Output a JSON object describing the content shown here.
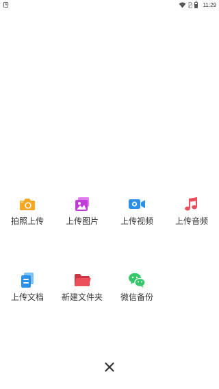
{
  "status_bar": {
    "left_icon": "a-notification-icon",
    "icons": [
      "wifi-icon",
      "no-sim-icon",
      "battery-icon"
    ],
    "battery_text": "",
    "battery_level": 0.6,
    "time": "11:29"
  },
  "actions": [
    {
      "label": "拍照上传",
      "icon": "camera-icon",
      "color": "#F5A623"
    },
    {
      "label": "上传图片",
      "icon": "image-icon",
      "color": "#C13BD8"
    },
    {
      "label": "上传视频",
      "icon": "video-icon",
      "color": "#2B8FE8"
    },
    {
      "label": "上传音频",
      "icon": "music-note-icon",
      "color": "#EC4E5E"
    },
    {
      "label": "上传文档",
      "icon": "document-icon",
      "color": "#2B8FE8"
    },
    {
      "label": "新建文件夹",
      "icon": "folder-icon",
      "color": "#EE4D5C"
    },
    {
      "label": "微信备份",
      "icon": "wechat-icon",
      "color": "#36C66B"
    }
  ],
  "close": {
    "icon": "close-icon"
  }
}
